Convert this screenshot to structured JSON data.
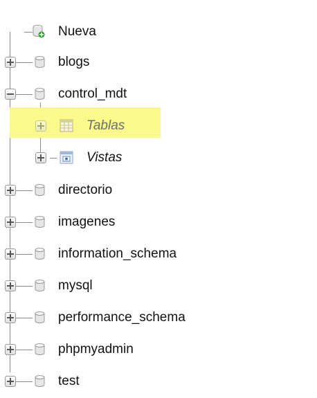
{
  "tree": {
    "new_label": "Nueva",
    "databases": [
      {
        "label": "blogs",
        "expanded": false
      },
      {
        "label": "control_mdt",
        "expanded": true,
        "children": [
          {
            "label": "Tablas",
            "icon": "table-icon",
            "highlighted": true
          },
          {
            "label": "Vistas",
            "icon": "view-icon",
            "highlighted": false
          }
        ]
      },
      {
        "label": "directorio",
        "expanded": false
      },
      {
        "label": "imagenes",
        "expanded": false
      },
      {
        "label": "information_schema",
        "expanded": false
      },
      {
        "label": "mysql",
        "expanded": false
      },
      {
        "label": "performance_schema",
        "expanded": false
      },
      {
        "label": "phpmyadmin",
        "expanded": false
      },
      {
        "label": "test",
        "expanded": false
      }
    ]
  },
  "colors": {
    "highlight": "#fafb8a",
    "connector": "#8a8a8a",
    "new_badge": "#2fa32f"
  }
}
